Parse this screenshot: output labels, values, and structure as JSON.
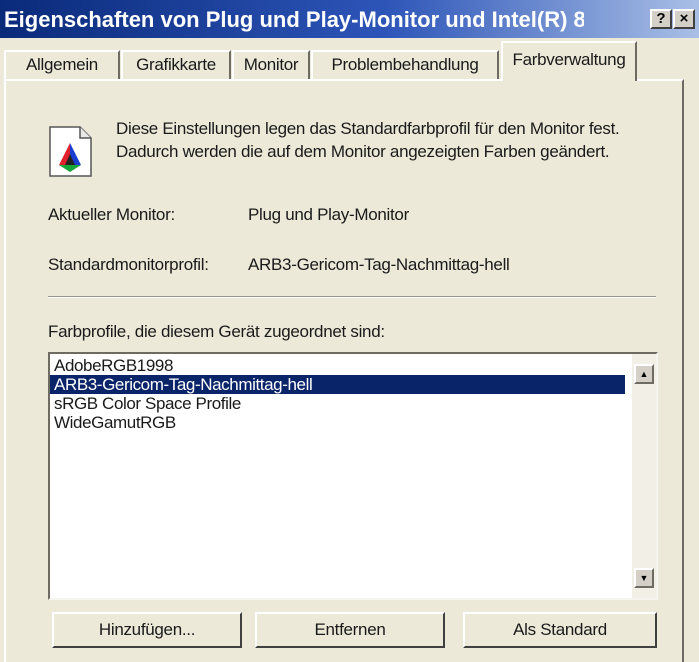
{
  "window": {
    "title": "Eigenschaften von Plug und Play-Monitor und Intel(R) 8...",
    "help_glyph": "?",
    "close_glyph": "×"
  },
  "tabs": [
    {
      "label": "Allgemein",
      "active": false
    },
    {
      "label": "Grafikkarte",
      "active": false
    },
    {
      "label": "Monitor",
      "active": false
    },
    {
      "label": "Problembehandlung",
      "active": false
    },
    {
      "label": "Farbverwaltung",
      "active": true
    }
  ],
  "main": {
    "icon": "color-profile-icon",
    "description": "Diese Einstellungen legen das Standardfarbprofil für den Monitor fest. Dadurch werden die auf dem Monitor angezeigten Farben geändert.",
    "current_monitor_label": "Aktueller Monitor:",
    "current_monitor_value": "Plug und Play-Monitor",
    "default_profile_label": "Standardmonitorprofil:",
    "default_profile_value": "ARB3-Gericom-Tag-Nachmittag-hell",
    "list_label": "Farbprofile, die diesem Gerät zugeordnet sind:",
    "profiles": [
      "AdobeRGB1998",
      "ARB3-Gericom-Tag-Nachmittag-hell",
      "sRGB Color Space Profile",
      "WideGamutRGB"
    ],
    "selected_index": 1
  },
  "buttons": {
    "add": "Hinzufügen...",
    "remove": "Entfernen",
    "set_default": "Als Standard"
  },
  "colors": {
    "title_bar": "#0a2a7a",
    "selection": "#0a246a",
    "face": "#ece9d8"
  }
}
